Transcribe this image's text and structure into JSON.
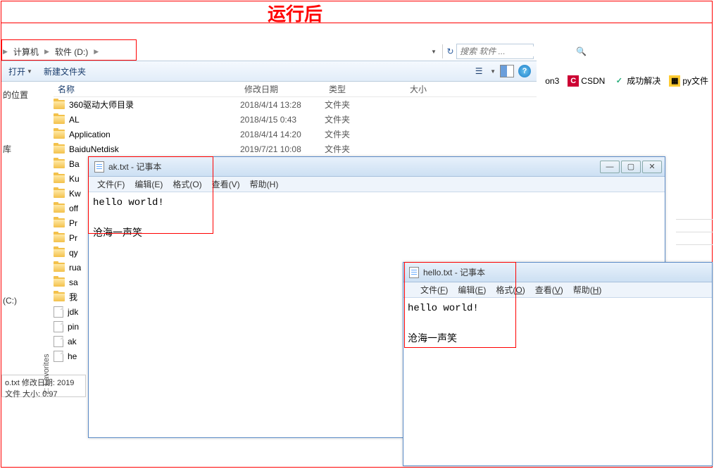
{
  "banner": "运行后",
  "breadcrumb": {
    "root": "计算机",
    "drive": "软件 (D:)"
  },
  "search": {
    "placeholder": "搜索 软件 ..."
  },
  "toolbar": {
    "open": "打开",
    "newfolder": "新建文件夹"
  },
  "sidebar_left": {
    "pos": "的位置",
    "lib": "库",
    "c": "(C:)"
  },
  "columns": {
    "name": "名称",
    "date": "修改日期",
    "type": "类型",
    "size": "大小"
  },
  "rows": [
    {
      "name": "360驱动大师目录",
      "date": "2018/4/14 13:28",
      "type": "文件夹",
      "ico": "folder"
    },
    {
      "name": "AL",
      "date": "2018/4/15 0:43",
      "type": "文件夹",
      "ico": "folder"
    },
    {
      "name": "Application",
      "date": "2018/4/14 14:20",
      "type": "文件夹",
      "ico": "folder"
    },
    {
      "name": "BaiduNetdisk",
      "date": "2019/7/21 10:08",
      "type": "文件夹",
      "ico": "folder"
    },
    {
      "name": "Ba",
      "date": "",
      "type": "",
      "ico": "folder"
    },
    {
      "name": "Ku",
      "date": "",
      "type": "",
      "ico": "folder"
    },
    {
      "name": "Kw",
      "date": "",
      "type": "",
      "ico": "folder"
    },
    {
      "name": "off",
      "date": "",
      "type": "",
      "ico": "folder"
    },
    {
      "name": "Pr",
      "date": "",
      "type": "",
      "ico": "folder"
    },
    {
      "name": "Pr",
      "date": "",
      "type": "",
      "ico": "folder"
    },
    {
      "name": "qy",
      "date": "",
      "type": "",
      "ico": "folder"
    },
    {
      "name": "rua",
      "date": "",
      "type": "",
      "ico": "folder"
    },
    {
      "name": "sa",
      "date": "",
      "type": "",
      "ico": "folder"
    },
    {
      "name": "我",
      "date": "",
      "type": "",
      "ico": "folder"
    },
    {
      "name": "jdk",
      "date": "",
      "type": "",
      "ico": "file"
    },
    {
      "name": "pin",
      "date": "",
      "type": "",
      "ico": "file"
    },
    {
      "name": "ak",
      "date": "",
      "type": "",
      "ico": "file"
    },
    {
      "name": "he",
      "date": "",
      "type": "",
      "ico": "file"
    }
  ],
  "notepad1": {
    "title": "ak.txt - 记事本",
    "menu": {
      "file": "文件(F)",
      "edit": "编辑(E)",
      "format": "格式(O)",
      "view": "查看(V)",
      "help": "帮助(H)"
    },
    "line1": "hello world!",
    "line2": "沧海一声笑"
  },
  "notepad2": {
    "title": "hello.txt - 记事本",
    "menu": {
      "file": "文件(F)",
      "edit": "编辑(E)",
      "format": "格式(O)",
      "view": "查看(V)",
      "help": "帮助(H)"
    },
    "line1": "hello world!",
    "line2": "沧海一声笑"
  },
  "ctrls": {
    "min": "—",
    "max": "▢",
    "close": "✕"
  },
  "shortcuts": {
    "on3": "on3",
    "csdn": "CSDN",
    "solve": "成功解决",
    "py": "py文件"
  },
  "tooltip": {
    "l1": "o.txt  修改日期: 2019",
    "l2": "文件         大小: 0.97"
  },
  "fav": "2: Favorites"
}
